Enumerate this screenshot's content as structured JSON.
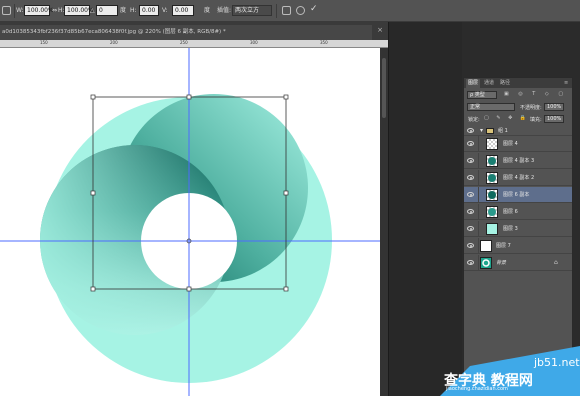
{
  "options_bar": {
    "width_value": "100.00%",
    "height_value": "100.00%",
    "angle_value": "0",
    "angle_unit": "度",
    "h_label": "H:",
    "h_value": "0.00",
    "v_label": "V:",
    "v_value": "0.00",
    "skew_unit": "度",
    "interp_label": "插值:",
    "interp_value": "两次立方"
  },
  "document": {
    "tab_title": "a0d10385343fbf236f37d85b67eca806438f0f.jpg @ 220% (图层 6 副本, RGB/8#) *"
  },
  "ruler": {
    "ticks": [
      "150",
      "200",
      "250",
      "300",
      "350"
    ]
  },
  "layers_panel": {
    "tabs": [
      "图层",
      "通道",
      "路径"
    ],
    "kind_label": "ρ 类型",
    "blend_mode": "正常",
    "opacity_label": "不透明度:",
    "opacity_value": "100%",
    "lock_label": "锁定:",
    "fill_label": "填充:",
    "fill_value": "100%",
    "group_name": "组 1",
    "layers": [
      {
        "name": "图层 4"
      },
      {
        "name": "图层 4 副本 3"
      },
      {
        "name": "图层 4 副本 2"
      },
      {
        "name": "图层 6 副本"
      },
      {
        "name": "图层 6"
      },
      {
        "name": "图层 3"
      },
      {
        "name": "图层 7"
      },
      {
        "name": "背景"
      }
    ]
  },
  "colors": {
    "mint": "#a6f3e4",
    "teal_dark": "#0e6a5f",
    "selection": "#5e6e8c"
  },
  "watermark": {
    "site_top": "jb51.net",
    "site_main": "查字典 教程网",
    "site_url": "jiaocheng.chazidian.com"
  }
}
